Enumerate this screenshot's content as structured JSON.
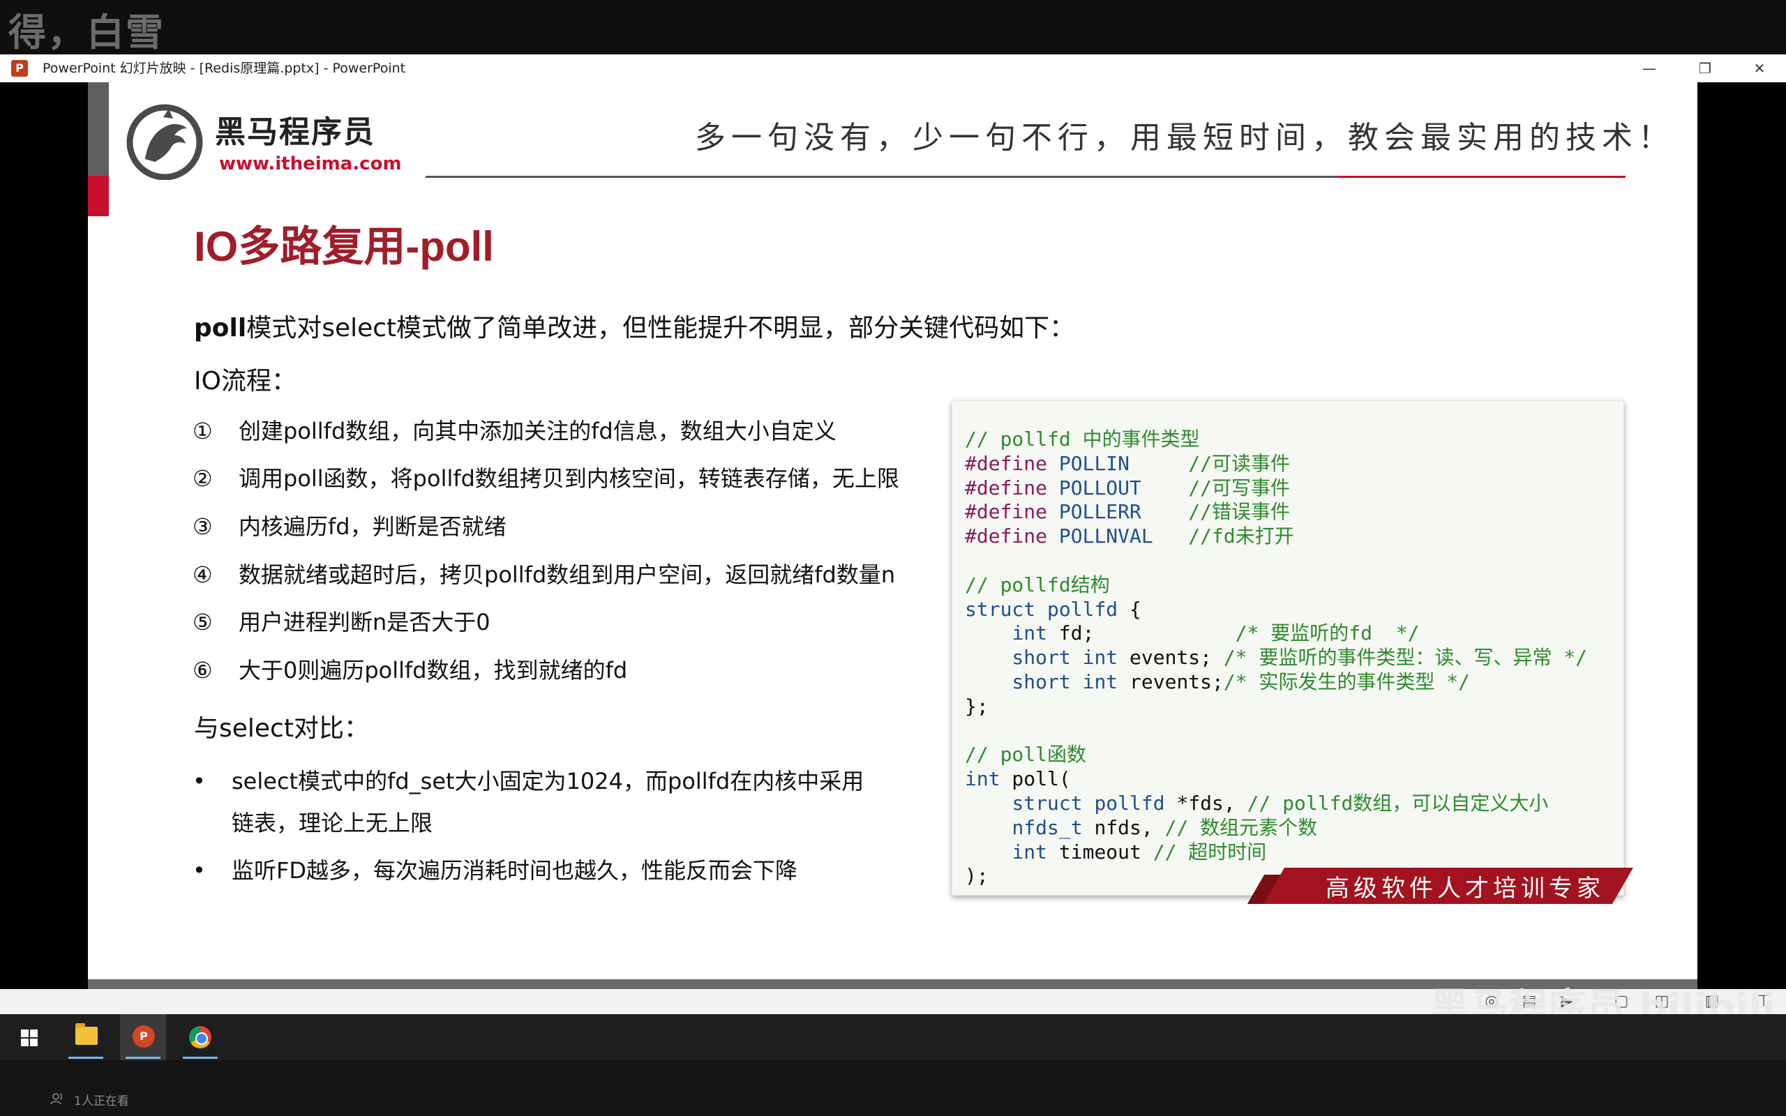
{
  "overlay": {
    "text": "得，白雪"
  },
  "window": {
    "icon_label": "P",
    "title": "PowerPoint 幻灯片放映 - [Redis原理篇.pptx] - PowerPoint",
    "controls": {
      "minimize": "—",
      "restore": "❐",
      "close": "✕"
    }
  },
  "slide": {
    "logo": {
      "name": "黑马程序员",
      "url": "www.itheima.com"
    },
    "slogan": "多一句没有，少一句不行，用最短时间，教会最实用的技术！",
    "title": "IO多路复用-poll",
    "intro_bold": "poll",
    "intro_rest": "模式对select模式做了简单改进，但性能提升不明显，部分关键代码如下：",
    "io_heading": "IO流程：",
    "steps": [
      {
        "num": "①",
        "text": "创建pollfd数组，向其中添加关注的fd信息，数组大小自定义"
      },
      {
        "num": "②",
        "text": "调用poll函数，将pollfd数组拷贝到内核空间，转链表存储，无上限"
      },
      {
        "num": "③",
        "text": "内核遍历fd，判断是否就绪"
      },
      {
        "num": "④",
        "text": "数据就绪或超时后，拷贝pollfd数组到用户空间，返回就绪fd数量n"
      },
      {
        "num": "⑤",
        "text": "用户进程判断n是否大于0"
      },
      {
        "num": "⑥",
        "text": "大于0则遍历pollfd数组，找到就绪的fd"
      }
    ],
    "compare_heading": "与select对比：",
    "bullets": [
      {
        "dot": "•",
        "line1": "select模式中的fd_set大小固定为1024，而pollfd在内核中采用",
        "line2": "链表，理论上无上限"
      },
      {
        "dot": "•",
        "line1": "监听FD越多，每次遍历消耗时间也越久，性能反而会下降",
        "line2": ""
      }
    ],
    "code": {
      "c1": "// pollfd 中的事件类型",
      "d1": "#define",
      "n1": " POLLIN     ",
      "cm1": "//可读事件",
      "d2": "#define",
      "n2": " POLLOUT    ",
      "cm2": "//可写事件",
      "d3": "#define",
      "n3": " POLLERR    ",
      "cm3": "//错误事件",
      "d4": "#define",
      "n4": " POLLNVAL   ",
      "cm4": "//fd未打开",
      "c2": "// pollfd结构",
      "s_kw": "struct",
      "s_ty": " pollfd",
      "s_br": " {",
      "f1_pre": "    ",
      "f1_ty": "int",
      "f1_id": " fd;            ",
      "f1_cm": "/* 要监听的fd  */",
      "f2_pre": "    ",
      "f2_ty": "short int",
      "f2_id": " events; ",
      "f2_cm": "/* 要监听的事件类型：读、写、异常 */",
      "f3_pre": "    ",
      "f3_ty": "short int",
      "f3_id": " revents;",
      "f3_cm": "/* 实际发生的事件类型 */",
      "s_end": "};",
      "c3": "// poll函数",
      "p_ty": "int",
      "p_id": " poll(",
      "a1_pre": "    ",
      "a1_kw": "struct",
      "a1_ty": " pollfd",
      "a1_id": " *fds, ",
      "a1_cm": "// pollfd数组，可以自定义大小",
      "a2_pre": "    ",
      "a2_ty": "nfds_t",
      "a2_id": " nfds, ",
      "a2_cm": "// 数组元素个数",
      "a3_pre": "    ",
      "a3_ty": "int",
      "a3_id": " timeout ",
      "a3_cm": "// 超时时间",
      "p_end": ");"
    },
    "banner": "高级软件人才培训专家"
  },
  "watermark": "黑马程序员 bilibili",
  "controlbar": {
    "icons": [
      "◎",
      "▤",
      "▶",
      "▢",
      "◫",
      "▥",
      "⊤"
    ]
  },
  "taskbar": {
    "ppt_label": "P"
  },
  "footer": {
    "viewers": "1人正在看"
  }
}
